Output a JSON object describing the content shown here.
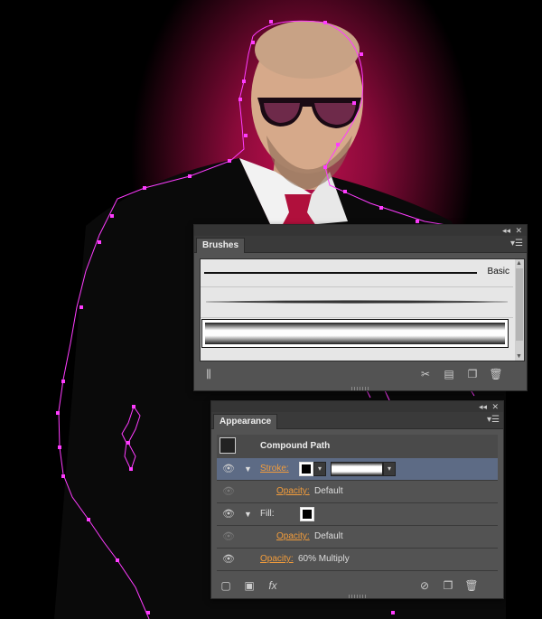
{
  "brushes_panel": {
    "tab_label": "Brushes",
    "collapse_icon": "double-chevron-left-icon",
    "close_icon": "close-icon",
    "menu_icon": "panel-menu-icon",
    "brushes": [
      {
        "name": "Basic",
        "style": "thin-line"
      },
      {
        "name": "",
        "style": "tapered-line"
      },
      {
        "name": "",
        "style": "gradient-band",
        "selected": true
      }
    ],
    "toolbar": [
      "brush-libraries-icon",
      "remove-brush-stroke-icon",
      "brush-options-icon",
      "new-brush-icon",
      "delete-brush-icon"
    ]
  },
  "appearance_panel": {
    "tab_label": "Appearance",
    "object_type": "Compound Path",
    "rows": {
      "stroke_label": "Stroke:",
      "stroke_opacity_label": "Opacity:",
      "stroke_opacity_value": "Default",
      "fill_label": "Fill:",
      "fill_opacity_label": "Opacity:",
      "fill_opacity_value": "Default",
      "object_opacity_label": "Opacity:",
      "object_opacity_value": "60% Multiply"
    },
    "toolbar": [
      "add-new-stroke-icon",
      "add-new-fill-icon",
      "fx",
      "clear-appearance-icon",
      "duplicate-item-icon",
      "delete-item-icon"
    ],
    "fx_label": "fx"
  },
  "colors": {
    "accent_link": "#f19c3c",
    "path_selection": "#ff3cff",
    "vignette": "#c0104e",
    "selected_row": "#5d6b85"
  }
}
